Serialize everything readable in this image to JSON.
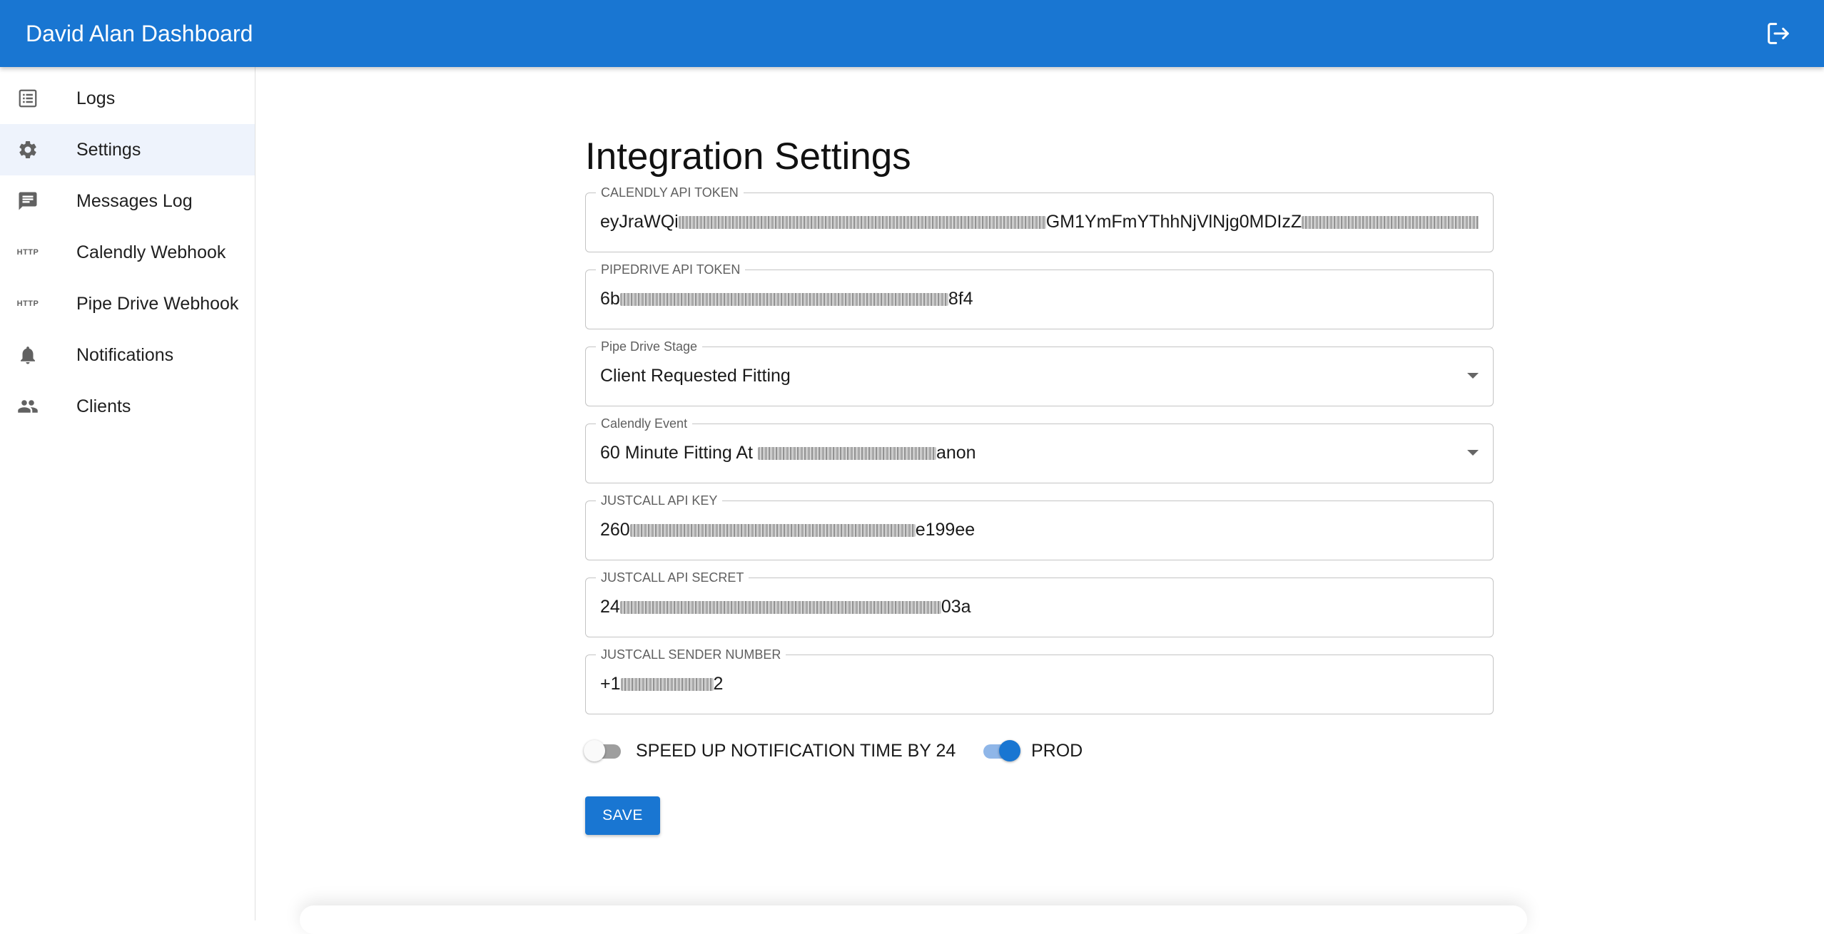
{
  "appbar": {
    "title": "David Alan Dashboard",
    "logout_icon": "logout-icon"
  },
  "sidebar": {
    "items": [
      {
        "label": "Logs",
        "icon": "list-icon",
        "active": false
      },
      {
        "label": "Settings",
        "icon": "gear-icon",
        "active": true
      },
      {
        "label": "Messages Log",
        "icon": "message-icon",
        "active": false
      },
      {
        "label": "Calendly Webhook",
        "icon": "http-icon",
        "icon_text": "HTTP",
        "active": false
      },
      {
        "label": "Pipe Drive Webhook",
        "icon": "http-icon",
        "icon_text": "HTTP",
        "active": false
      },
      {
        "label": "Notifications",
        "icon": "bell-icon",
        "active": false
      },
      {
        "label": "Clients",
        "icon": "people-icon",
        "active": false
      }
    ]
  },
  "main": {
    "title": "Integration Settings",
    "fields": {
      "calendly_api_token": {
        "label": "CALENDLY API TOKEN",
        "value_start": "eyJraWQi",
        "value_mid": "GM1YmFmYThhNjVlNjg0MDIzZ"
      },
      "pipedrive_api_token": {
        "label": "PIPEDRIVE API TOKEN",
        "value_start": "6b",
        "value_end": "8f4"
      },
      "pipe_drive_stage": {
        "label": "Pipe Drive Stage",
        "value": "Client Requested Fitting"
      },
      "calendly_event": {
        "label": "Calendly Event",
        "value_start": "60 Minute Fitting At ",
        "value_end": "anon"
      },
      "justcall_api_key": {
        "label": "JUSTCALL API KEY",
        "value_start": "260",
        "value_end": "e199ee"
      },
      "justcall_api_secret": {
        "label": "JUSTCALL API SECRET",
        "value_start": "24",
        "value_end": "03a"
      },
      "justcall_sender_number": {
        "label": "JUSTCALL SENDER NUMBER",
        "value_start": "+1",
        "value_end": "2"
      }
    },
    "toggles": {
      "speed_up": {
        "label": "SPEED UP NOTIFICATION TIME BY 24",
        "checked": false
      },
      "prod": {
        "label": "PROD",
        "checked": true
      }
    },
    "save_label": "SAVE"
  },
  "colors": {
    "primary": "#1976d2",
    "active_nav_bg": "#eef3fc",
    "border": "#c4c4c4"
  }
}
